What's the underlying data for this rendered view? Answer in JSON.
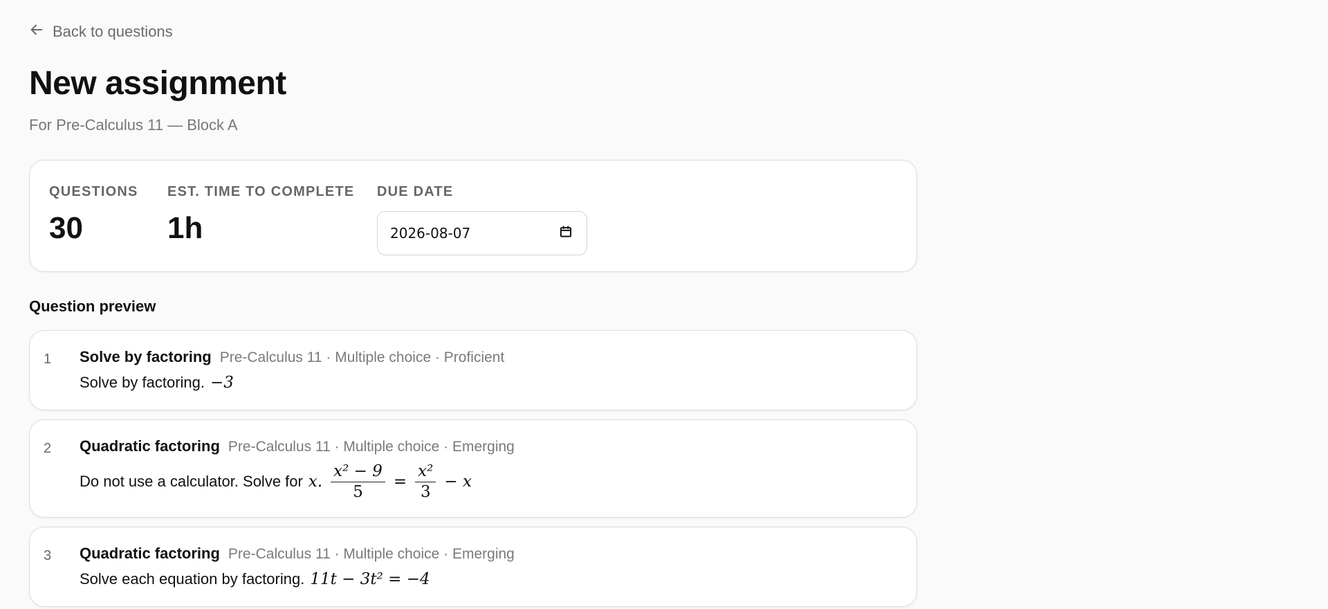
{
  "nav": {
    "back_label": "Back to questions"
  },
  "header": {
    "title": "New assignment",
    "subtitle": "For Pre-Calculus 11 — Block A"
  },
  "stats": {
    "questions_label": "QUESTIONS",
    "questions_value": "30",
    "time_label": "EST. TIME TO COMPLETE",
    "time_value": "1h",
    "due_label": "DUE DATE",
    "due_value": "2026-08-07"
  },
  "preview": {
    "heading": "Question preview",
    "questions": [
      {
        "number": "1",
        "title": "Solve by factoring",
        "meta": "Pre-Calculus 11 · Multiple choice · Proficient",
        "prompt": "Solve by factoring.",
        "math": "−3"
      },
      {
        "number": "2",
        "title": "Quadratic factoring",
        "meta": "Pre-Calculus 11 · Multiple choice · Emerging",
        "prompt": "Do not use a calculator. Solve for",
        "math_var": "x.",
        "frac1_num": "x² − 9",
        "frac1_den": "5",
        "equals": "=",
        "frac2_num": "x²",
        "frac2_den": "3",
        "tail": "− x"
      },
      {
        "number": "3",
        "title": "Quadratic factoring",
        "meta": "Pre-Calculus 11 · Multiple choice · Emerging",
        "prompt": "Solve each equation by factoring.",
        "math": "11t − 3t² = −4"
      }
    ]
  },
  "icons": {
    "back": "arrow-left-icon",
    "calendar": "calendar-icon"
  },
  "colors": {
    "background": "#fafafa",
    "card": "#ffffff",
    "border": "#dddddd",
    "muted_text": "#777777"
  }
}
